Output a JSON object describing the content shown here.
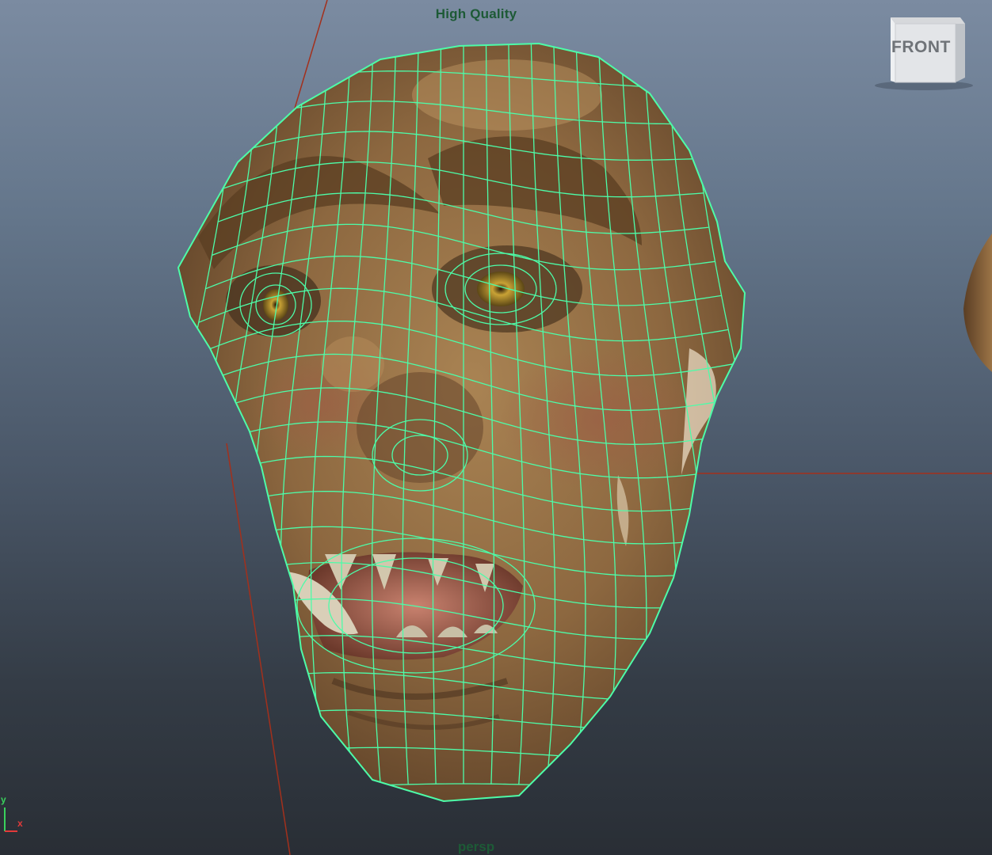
{
  "viewport": {
    "quality_label": "High Quality",
    "camera_label": "persp"
  },
  "view_cube": {
    "face_label": "FRONT"
  },
  "axis_indicator": {
    "y_label": "y",
    "x_label": "x"
  },
  "colors": {
    "wireframe": "#4dfca8",
    "grid_line": "#a3301c",
    "skin": "#9a7448",
    "skin_shadow": "#5e4128",
    "label": "#1d5a36"
  },
  "icons": {
    "axis_indicator": "axis-gizmo-icon",
    "view_cube": "view-cube-icon"
  }
}
